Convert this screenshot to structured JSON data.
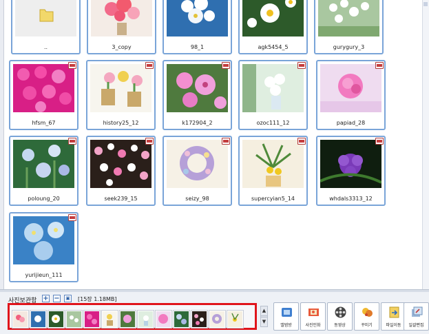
{
  "photos": [
    {
      "name": ".."
    },
    {
      "name": "3_copy"
    },
    {
      "name": "98_1"
    },
    {
      "name": "agk5454_5"
    },
    {
      "name": "gurygury_3"
    },
    {
      "name": "hfsm_67"
    },
    {
      "name": "history25_12"
    },
    {
      "name": "k172904_2"
    },
    {
      "name": "ozoc111_12"
    },
    {
      "name": "papiad_28"
    },
    {
      "name": "poloung_20"
    },
    {
      "name": "seek239_15"
    },
    {
      "name": "seizy_98"
    },
    {
      "name": "supercyian5_14"
    },
    {
      "name": "whdals3313_12"
    },
    {
      "name": "yurijieun_111"
    }
  ],
  "storage": {
    "label": "사진보관함",
    "add_icon": "plus-icon",
    "remove_icon": "minus-icon",
    "delete_icon": "trash-icon",
    "count_text": "[15장 1.18MB]",
    "highlight_color": "#e0141b"
  },
  "strip_count": 14,
  "tools": [
    {
      "label": "앨범방",
      "icon": "album-icon"
    },
    {
      "label": "사진인화",
      "icon": "photo-print-icon"
    },
    {
      "label": "동영상",
      "icon": "film-reel-icon"
    },
    {
      "label": "꾸미기",
      "icon": "decorate-icon"
    },
    {
      "label": "파일이동",
      "icon": "file-move-icon"
    },
    {
      "label": "일괄편집",
      "icon": "batch-edit-icon"
    }
  ]
}
